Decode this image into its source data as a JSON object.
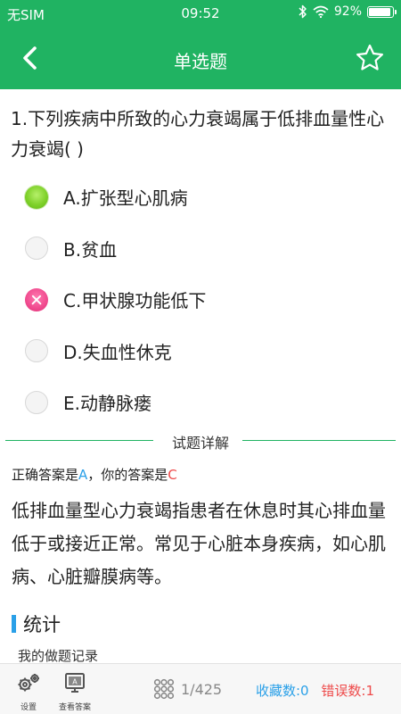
{
  "status": {
    "carrier": "无SIM",
    "time": "09:52",
    "battery": "92%",
    "battery_level": 0.92
  },
  "nav": {
    "title": "单选题",
    "back_icon": "chevron-left-icon",
    "favorite_icon": "star-outline-icon"
  },
  "question": {
    "text": "1.下列疾病中所致的心力衰竭属于低排血量性心力衰竭( )"
  },
  "options": [
    {
      "label": "A.扩张型心肌病",
      "state": "correct"
    },
    {
      "label": "B.贫血",
      "state": "none"
    },
    {
      "label": "C.甲状腺功能低下",
      "state": "wrong"
    },
    {
      "label": "D.失血性休克",
      "state": "none"
    },
    {
      "label": "E.动静脉瘘",
      "state": "none"
    }
  ],
  "detail": {
    "section_title": "试题详解",
    "correct_prefix": "正确答案是",
    "correct_answer": "A",
    "separator": "，你的答案是",
    "user_answer": "C",
    "explanation": "低排血量型心力衰竭指患者在休息时其心排血量低于或接近正常。常见于心脏本身疾病，如心肌病、心脏瓣膜病等。"
  },
  "stats": {
    "title": "统计",
    "record_label": "我的做题记录"
  },
  "bottom": {
    "settings_label": "设置",
    "view_answer_label": "查看答案",
    "page": "1/425",
    "favorites": "收藏数:0",
    "errors": "错误数:1"
  },
  "colors": {
    "brand": "#20b362",
    "accent_blue": "#2aa0e8",
    "error_red": "#ee4a4a",
    "correct_green": "#7fd12a",
    "wrong_pink": "#f04a8e"
  }
}
